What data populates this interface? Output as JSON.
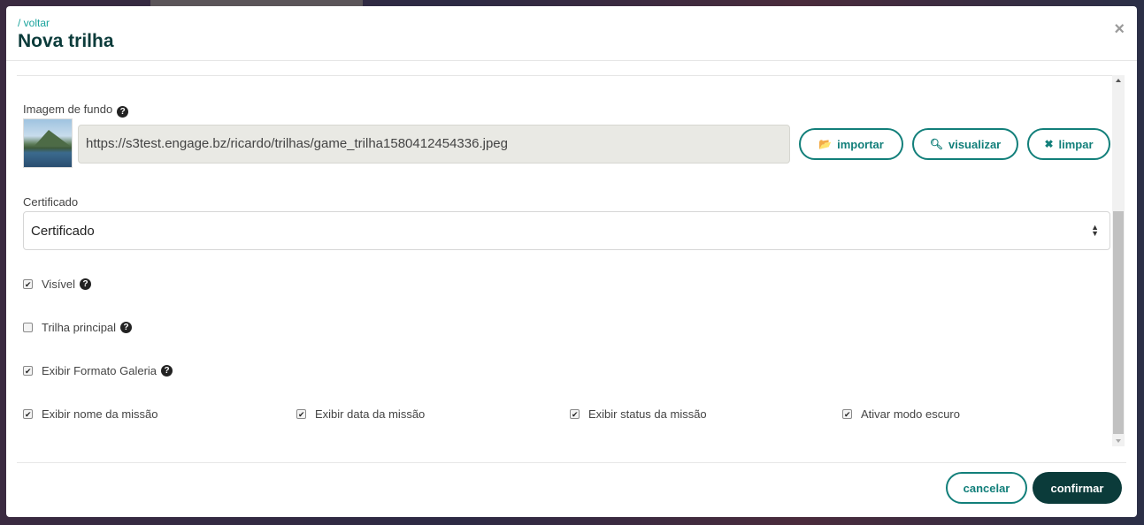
{
  "header": {
    "back_link": "/ voltar",
    "title": "Nova trilha",
    "close": "×"
  },
  "background_image": {
    "label": "Imagem de fundo",
    "url_value": "https://s3test.engage.bz/ricardo/trilhas/game_trilha1580412454336.jpeg",
    "buttons": {
      "import": "importar",
      "view": "visualizar",
      "clear": "limpar"
    }
  },
  "certificate": {
    "label": "Certificado",
    "selected": "Certificado"
  },
  "options": {
    "visible": {
      "label": "Visível",
      "checked": true
    },
    "main_track": {
      "label": "Trilha principal",
      "checked": false
    },
    "gallery": {
      "label": "Exibir Formato Galeria",
      "checked": true
    },
    "show_mission_name": {
      "label": "Exibir nome da missão",
      "checked": true
    },
    "show_mission_date": {
      "label": "Exibir data da missão",
      "checked": true
    },
    "show_mission_status": {
      "label": "Exibir status da missão",
      "checked": true
    },
    "dark_mode": {
      "label": "Ativar modo escuro",
      "checked": true
    }
  },
  "footer": {
    "cancel": "cancelar",
    "confirm": "confirmar"
  },
  "colors": {
    "accent": "#127f7a",
    "primary_dark": "#0b3b3a",
    "link": "#1aa39c"
  },
  "icons": {
    "help": "question-circle-icon",
    "import": "folder-open-icon",
    "view": "search-icon",
    "clear": "times-icon"
  }
}
